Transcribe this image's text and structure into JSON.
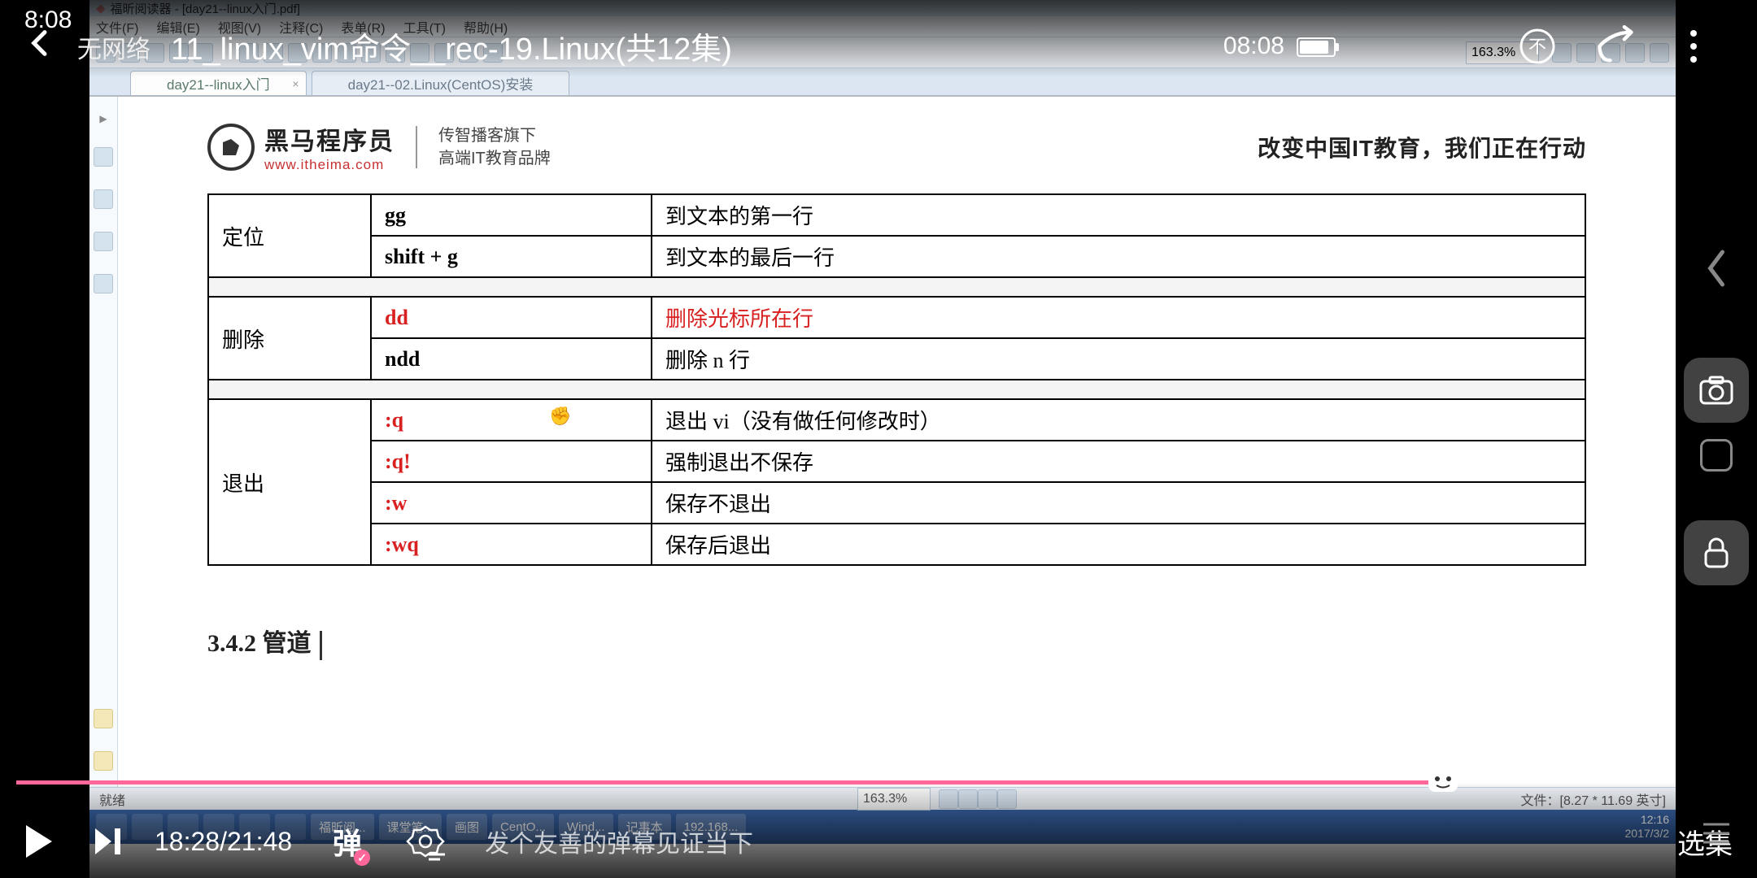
{
  "phone": {
    "time": "8:08"
  },
  "player": {
    "net_status": "无网络",
    "title": "11_linux_vim命令__rec-19.Linux(共12集)",
    "top_time": "08:08",
    "time_current": "18:28",
    "time_total": "21:48",
    "danmu_label": "弹",
    "danmu_placeholder": "发个友善的弹幕见证当下",
    "episodes_label": "选集"
  },
  "desktop": {
    "app_title": "福昕阅读器 - [day21--linux入门.pdf]",
    "menu": [
      "文件(F)",
      "编辑(E)",
      "视图(V)",
      "注释(C)",
      "表单(R)",
      "工具(T)",
      "帮助(H)"
    ],
    "tabs": [
      {
        "label": "day21--linux入门",
        "active": true
      },
      {
        "label": "day21--02.Linux(CentOS)安装",
        "active": false
      }
    ],
    "zoom": "163.3%",
    "status_left": "就绪",
    "status_right": "文件：[8.27 * 11.69 英寸]",
    "taskbar_items": [
      "福昕阅...",
      "课堂笔...",
      "",
      "画图",
      "CentO...",
      "Wind...",
      "记事本",
      "192.168..."
    ],
    "tray_time": "12:16",
    "tray_date": "2017/3/2"
  },
  "page": {
    "logo_main": "黑马程序员",
    "logo_url": "www.itheima.com",
    "logo_sub1": "传智播客旗下",
    "logo_sub2": "高端IT教育品牌",
    "slogan": "改变中国IT教育，我们正在行动",
    "table": {
      "groups": [
        {
          "label": "定位",
          "rows": [
            {
              "cmd": "gg",
              "desc": "到文本的第一行",
              "highlight": false
            },
            {
              "cmd": "shift + g",
              "desc": "到文本的最后一行",
              "highlight": false
            }
          ]
        },
        {
          "label": "删除",
          "rows": [
            {
              "cmd": "dd",
              "desc": "删除光标所在行",
              "highlight": true
            },
            {
              "cmd": "ndd",
              "desc": "删除 n 行",
              "highlight": false
            }
          ]
        },
        {
          "label": "退出",
          "rows": [
            {
              "cmd": ":q",
              "desc": "退出 vi（没有做任何修改时）",
              "highlight": false,
              "cmd_red": true
            },
            {
              "cmd": ":q!",
              "desc": "强制退出不保存",
              "highlight": false,
              "cmd_red": true
            },
            {
              "cmd": ":w",
              "desc": "保存不退出",
              "highlight": false,
              "cmd_red": true
            },
            {
              "cmd": ":wq",
              "desc": "保存后退出",
              "highlight": false,
              "cmd_red": true
            }
          ]
        }
      ]
    },
    "section": "3.4.2  管道"
  }
}
